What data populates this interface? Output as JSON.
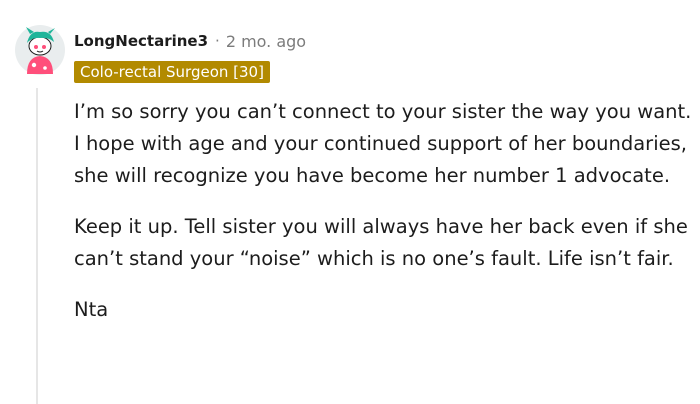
{
  "comment": {
    "author": "LongNectarine3",
    "separator": "·",
    "timestamp": "2 mo. ago",
    "flair": "Colo-rectal Surgeon [30]",
    "avatar": "snoo-avatar-icon",
    "paragraphs": [
      "I’m so sorry you can’t connect to your sister the way you want. I hope with age and your continued support of her boundaries, she will recognize you have become her number 1 advocate.",
      "Keep it up. Tell sister you will always have her back even if she can’t stand your “noise” which is no one’s fault. Life isn’t fair.",
      "Nta"
    ]
  },
  "colors": {
    "flair_bg": "#b28a00",
    "flair_text": "#ffffff",
    "avatar_bg": "#e9edee",
    "avatar_body": "#ff4f7b",
    "avatar_hair": "#1fb59a",
    "meta_text": "#7c7c7c",
    "thread_line": "#e6e6e6"
  }
}
